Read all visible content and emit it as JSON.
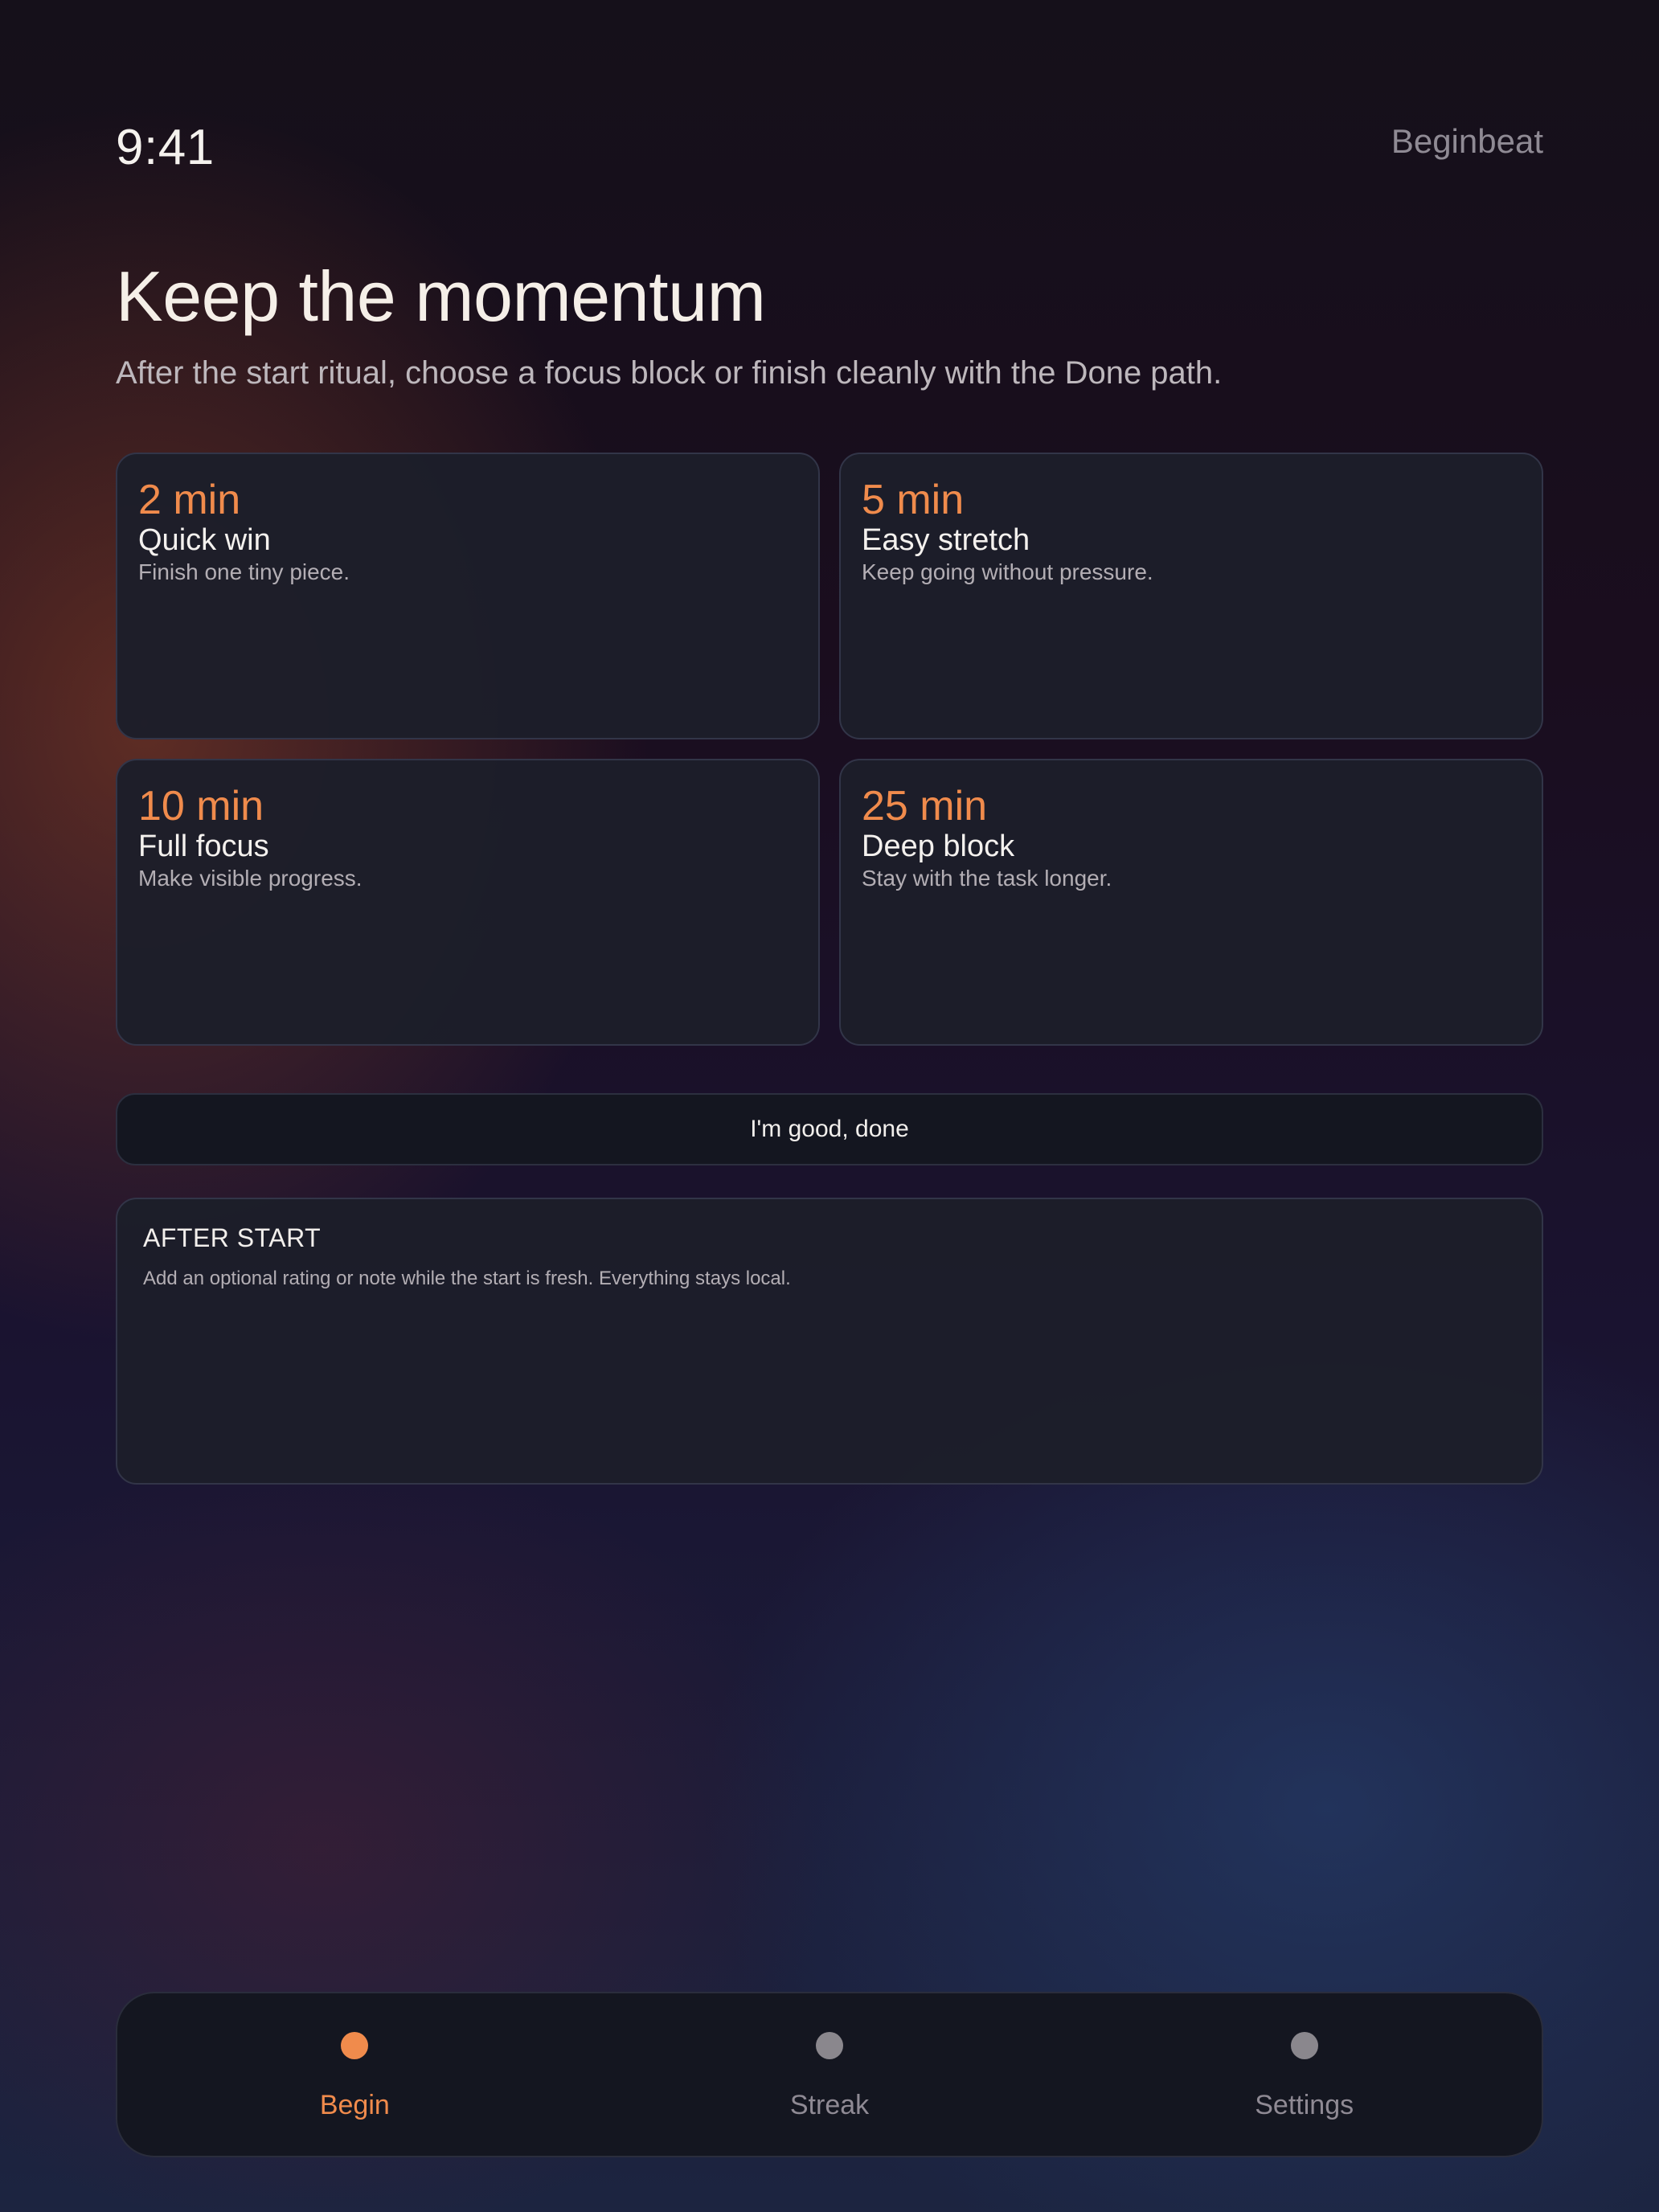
{
  "status": {
    "time": "9:41",
    "app_name": "Beginbeat"
  },
  "header": {
    "title": "Keep the momentum",
    "subtitle": "After the start ritual, choose a focus block or finish cleanly with the Done path."
  },
  "blocks": [
    {
      "duration": "2 min",
      "name": "Quick win",
      "description": "Finish one tiny piece."
    },
    {
      "duration": "5 min",
      "name": "Easy stretch",
      "description": "Keep going without pressure."
    },
    {
      "duration": "10 min",
      "name": "Full focus",
      "description": "Make visible progress."
    },
    {
      "duration": "25 min",
      "name": "Deep block",
      "description": "Stay with the task longer."
    }
  ],
  "done_button": {
    "label": "I'm good, done"
  },
  "after_start": {
    "heading": "AFTER START",
    "note": "Add an optional rating or note while the start is fresh. Everything stays local."
  },
  "tabs": [
    {
      "label": "Begin",
      "active": true
    },
    {
      "label": "Streak",
      "active": false
    },
    {
      "label": "Settings",
      "active": false
    }
  ],
  "colors": {
    "accent": "#f08b4c",
    "card": "#1c1e2a",
    "inactive": "#8a878d"
  }
}
